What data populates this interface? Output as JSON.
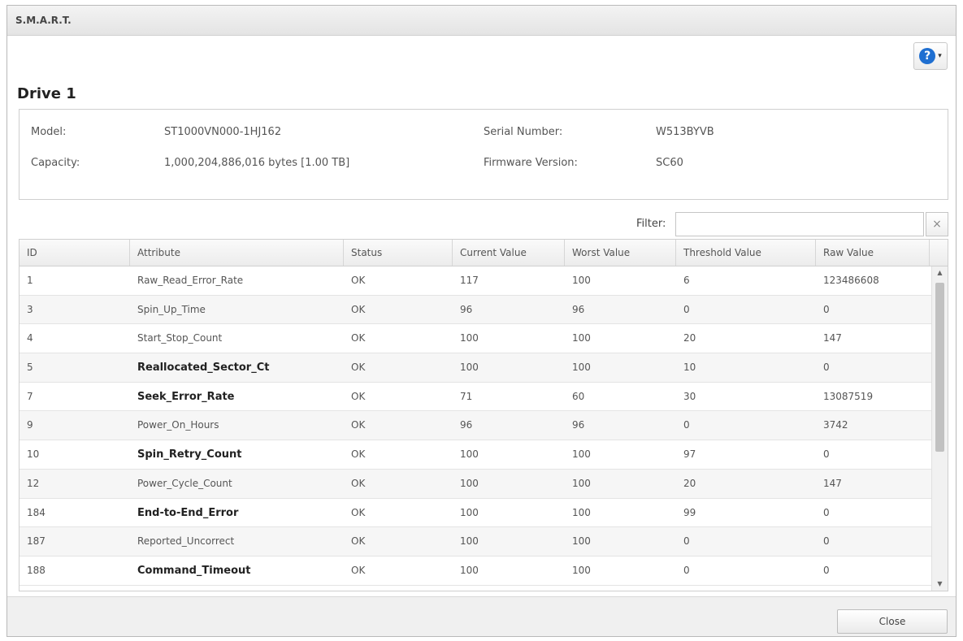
{
  "window": {
    "title": "S.M.A.R.T."
  },
  "help": {
    "icon": "help-icon",
    "symbol": "?",
    "caret": "▾"
  },
  "drive": {
    "title": "Drive 1",
    "model_label": "Model:",
    "model": "ST1000VN000-1HJ162",
    "capacity_label": "Capacity:",
    "capacity": "1,000,204,886,016 bytes [1.00 TB]",
    "serial_label": "Serial Number:",
    "serial": "W513BYVB",
    "firmware_label": "Firmware Version:",
    "firmware": "SC60"
  },
  "filter": {
    "label": "Filter:",
    "value": "",
    "clear": "×"
  },
  "table": {
    "headers": [
      "ID",
      "Attribute",
      "Status",
      "Current Value",
      "Worst Value",
      "Threshold Value",
      "Raw Value"
    ],
    "rows": [
      {
        "id": "1",
        "attribute": "Raw_Read_Error_Rate",
        "bold": false,
        "status": "OK",
        "current": "117",
        "worst": "100",
        "threshold": "6",
        "raw": "123486608"
      },
      {
        "id": "3",
        "attribute": "Spin_Up_Time",
        "bold": false,
        "status": "OK",
        "current": "96",
        "worst": "96",
        "threshold": "0",
        "raw": "0"
      },
      {
        "id": "4",
        "attribute": "Start_Stop_Count",
        "bold": false,
        "status": "OK",
        "current": "100",
        "worst": "100",
        "threshold": "20",
        "raw": "147"
      },
      {
        "id": "5",
        "attribute": "Reallocated_Sector_Ct",
        "bold": true,
        "status": "OK",
        "current": "100",
        "worst": "100",
        "threshold": "10",
        "raw": "0"
      },
      {
        "id": "7",
        "attribute": "Seek_Error_Rate",
        "bold": true,
        "status": "OK",
        "current": "71",
        "worst": "60",
        "threshold": "30",
        "raw": "13087519"
      },
      {
        "id": "9",
        "attribute": "Power_On_Hours",
        "bold": false,
        "status": "OK",
        "current": "96",
        "worst": "96",
        "threshold": "0",
        "raw": "3742"
      },
      {
        "id": "10",
        "attribute": "Spin_Retry_Count",
        "bold": true,
        "status": "OK",
        "current": "100",
        "worst": "100",
        "threshold": "97",
        "raw": "0"
      },
      {
        "id": "12",
        "attribute": "Power_Cycle_Count",
        "bold": false,
        "status": "OK",
        "current": "100",
        "worst": "100",
        "threshold": "20",
        "raw": "147"
      },
      {
        "id": "184",
        "attribute": "End-to-End_Error",
        "bold": true,
        "status": "OK",
        "current": "100",
        "worst": "100",
        "threshold": "99",
        "raw": "0"
      },
      {
        "id": "187",
        "attribute": "Reported_Uncorrect",
        "bold": false,
        "status": "OK",
        "current": "100",
        "worst": "100",
        "threshold": "0",
        "raw": "0"
      },
      {
        "id": "188",
        "attribute": "Command_Timeout",
        "bold": true,
        "status": "OK",
        "current": "100",
        "worst": "100",
        "threshold": "0",
        "raw": "0"
      }
    ]
  },
  "scrollbar": {
    "up": "▲",
    "down": "▼"
  },
  "footer": {
    "close_label": "Close"
  }
}
